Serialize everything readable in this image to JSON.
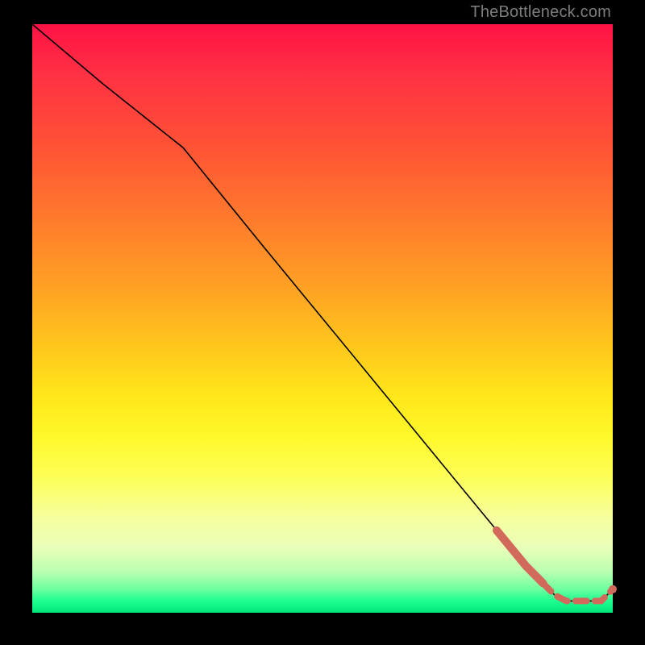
{
  "attribution": "TheBottleneck.com",
  "colors": {
    "curve": "#000000",
    "highlight": "#d26a5c",
    "gradient_top": "#ff1244",
    "gradient_bottom": "#00e57a",
    "page_bg": "#000000"
  },
  "chart_data": {
    "type": "line",
    "title": "",
    "xlabel": "",
    "ylabel": "",
    "xlim": [
      0,
      100
    ],
    "ylim": [
      0,
      100
    ],
    "grid": false,
    "legend": "none",
    "series": [
      {
        "name": "bottleneck-curve",
        "x": [
          0,
          12,
          26,
          40,
          55,
          70,
          80,
          85,
          88,
          90,
          92,
          94,
          96,
          98,
          100
        ],
        "y": [
          100,
          90,
          79,
          62,
          44,
          26,
          14,
          8,
          5,
          3,
          2,
          2,
          2,
          2,
          4
        ]
      }
    ],
    "highlight": {
      "name": "optimal-range",
      "style": "thick-then-dashed",
      "x": [
        80,
        85,
        88,
        90,
        92,
        94,
        96,
        98,
        100
      ],
      "y": [
        14,
        8,
        5,
        3,
        2,
        2,
        2,
        2,
        4
      ]
    }
  }
}
